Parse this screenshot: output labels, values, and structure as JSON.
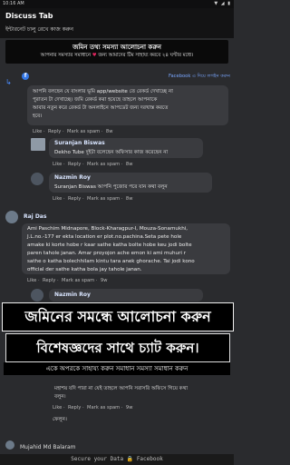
{
  "statusbar": {
    "time": "10:16 AM",
    "icons": "▼ ◢ ▮"
  },
  "appbar": {
    "title": "Discuss Tab",
    "subtitle": "ইন্টারনেট চালু রেখে কাজ করুন"
  },
  "notice": {
    "head": "জমিন তথ্য সমস্যা আলোচনা করুন",
    "body_before": "আপনার সমস্যার সমাধানে",
    "body_after": "জন্য আমাদের টিম সাহায্য করবে ২৪ ঘণ্টার মধ্যে।"
  },
  "fb_badge": {
    "icon": "f",
    "text": "Facebook এ দিয়ে লগইন করুন"
  },
  "comments": [
    {
      "name": "",
      "lines": [
        "আপনি বলছেন যে বাংলার ভূমি app/website তে রেকর্ড দেখাচ্ছে না",
        "পুরাতন টা দেখাচ্ছে। জমি রেকর্ড করা হয়েছে তাহলে আপনাকে",
        "আবার নতুন করে রেকর্ড টা অনলাইনে আপডেট জন্য দরখাস্ত করতে",
        "হবে।"
      ],
      "actions": [
        "Like",
        "Reply",
        "Mark as spam",
        "8w"
      ]
    },
    {
      "name": "Suranjan Biswas",
      "lines": [
        "Dekho Tube দুইটা বলেছেন অফিসার কাজ করেছেন না"
      ],
      "actions": [
        "Like",
        "Reply",
        "Mark as spam",
        "8w"
      ]
    },
    {
      "name": "Nazmin Roy",
      "lines": [
        "Suranjan Biswas আপনি পুজোর পরে যান কথা বলুন"
      ],
      "actions": [
        "Like",
        "Reply",
        "Mark as spam",
        "8w"
      ]
    },
    {
      "name": "Raj Das",
      "lines": [
        "Ami Paschim Midnapore, Block-Kharagpur-I, Mouza-Sonamukhi,",
        "J.L.no.-177 er ekta location er plot.no.pachina.Seta pete hole",
        "amake ki korte hobe r kaar sathe katha bolte hobe keu jodi bolte",
        "paren tahole janan. Amar proyojon ache emon ki ami muhuri r",
        "sathe o katha bolechhilam kintu tara anek ghorache. Tai jodi kono",
        "official der sathe katha bola jay tahole janan."
      ],
      "actions": [
        "Like",
        "Reply",
        "Mark as spam",
        "9w"
      ]
    },
    {
      "name": "Nazmin Roy",
      "lines": [
        "মহাশয় যদি পারা না যেই তাহলে আপনি সরাসরি অফিসে গিয়ে কথা",
        "বলুন।"
      ],
      "actions": [
        "Like",
        "Reply",
        "Mark as spam",
        "9w"
      ]
    }
  ],
  "promo": {
    "line1": "জমিনের সমন্ধে আলোচনা করুন",
    "line2": "বিশেষজ্ঞদের সাথে চ্যাট করুন।",
    "line3": "একে অপরকে সাহায্য করুন সমাধান সমস্যা সমাধান করুন"
  },
  "partial_text": "ফেলুন।",
  "last_name": "Mujahid Md Balaram",
  "secure": {
    "before": "Secure your Data",
    "after": "Facebook"
  }
}
